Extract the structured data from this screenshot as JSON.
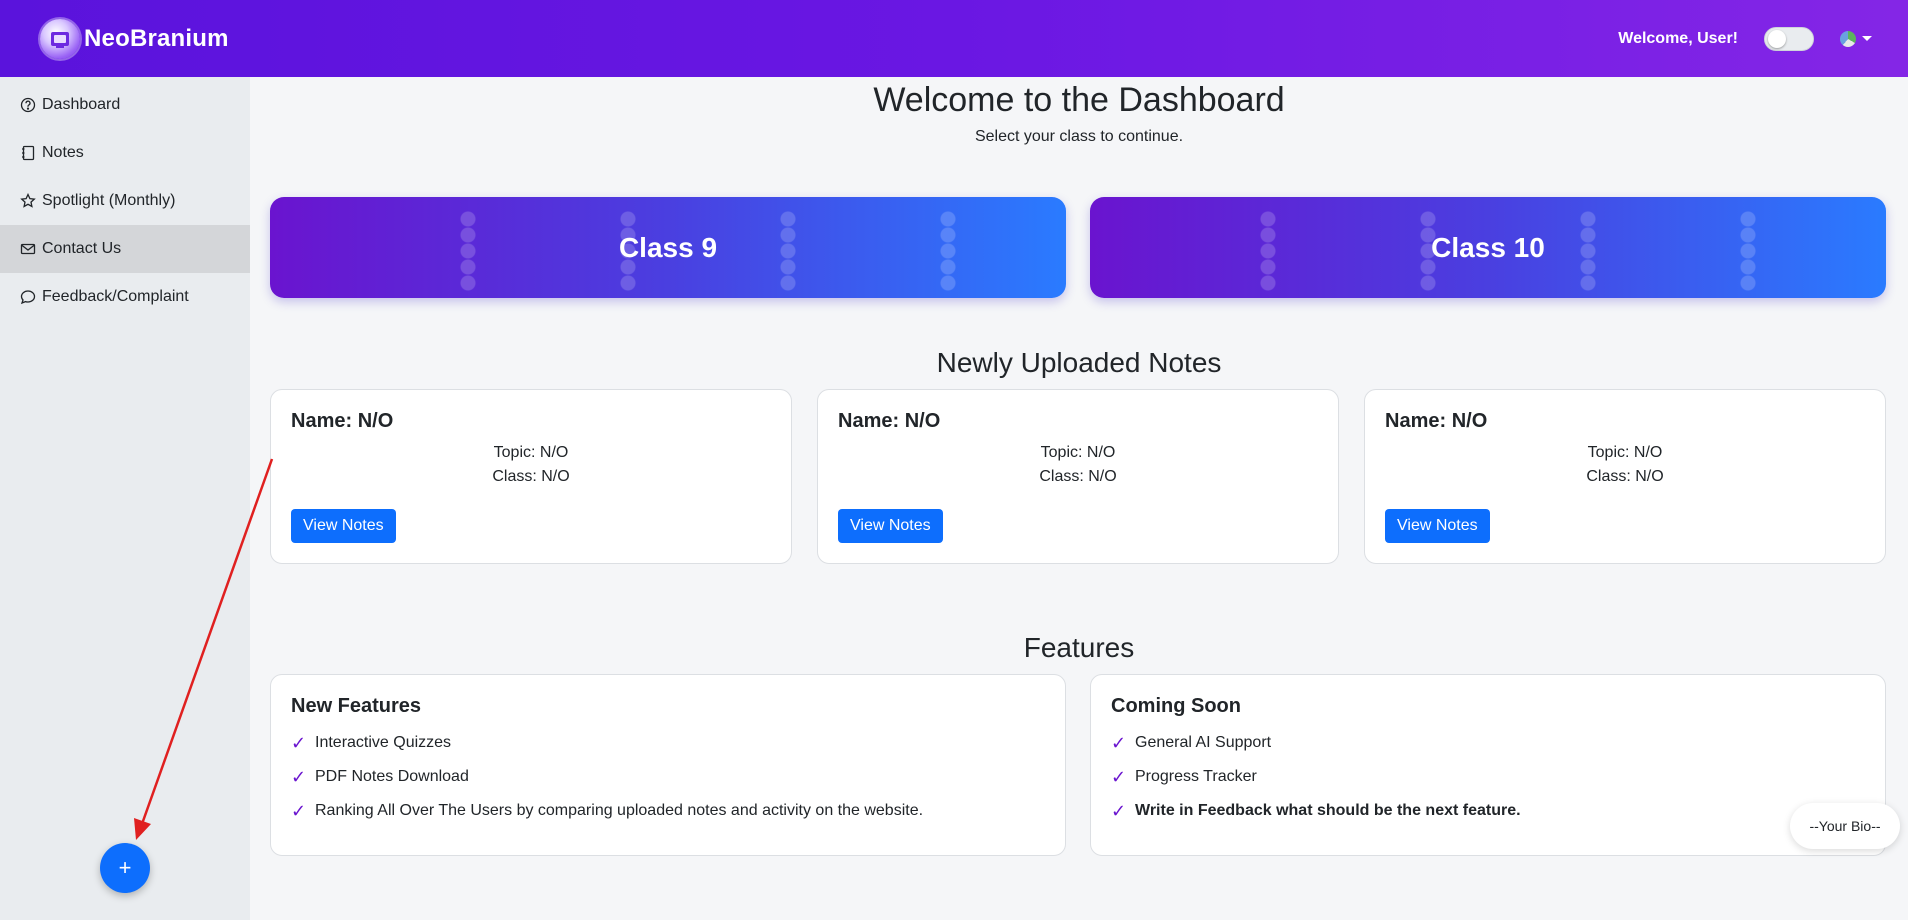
{
  "navbar": {
    "brand": "NeoBranium",
    "welcome": "Welcome, User!"
  },
  "sidebar": {
    "items": [
      {
        "label": "Dashboard",
        "icon": "question-circle-icon"
      },
      {
        "label": "Notes",
        "icon": "notebook-icon"
      },
      {
        "label": "Spotlight (Monthly)",
        "icon": "star-icon"
      },
      {
        "label": "Contact Us",
        "icon": "envelope-icon",
        "active": true
      },
      {
        "label": "Feedback/Complaint",
        "icon": "chat-bubble-icon"
      }
    ],
    "fab_label": "+"
  },
  "main": {
    "title": "Welcome to the Dashboard",
    "subtitle": "Select your class to continue.",
    "classes": [
      "Class 9",
      "Class 10"
    ],
    "notes_title": "Newly Uploaded Notes",
    "notes": [
      {
        "name": "Name: N/O",
        "topic": "Topic: N/O",
        "class": "Class: N/O",
        "button": "View Notes"
      },
      {
        "name": "Name: N/O",
        "topic": "Topic: N/O",
        "class": "Class: N/O",
        "button": "View Notes"
      },
      {
        "name": "Name: N/O",
        "topic": "Topic: N/O",
        "class": "Class: N/O",
        "button": "View Notes"
      }
    ],
    "features_title": "Features",
    "features": [
      {
        "title": "New Features",
        "items": [
          "Interactive Quizzes",
          "PDF Notes Download",
          "Ranking All Over The Users by comparing uploaded notes and activity on the website."
        ]
      },
      {
        "title": "Coming Soon",
        "items": [
          "General AI Support",
          "Progress Tracker",
          "Write in Feedback what should be the next feature."
        ]
      }
    ],
    "check_mark": "✓"
  },
  "bio": "--Your Bio--",
  "colors": {
    "nav_gradient_start": "#5a13dc",
    "nav_gradient_end": "#8426e6",
    "primary_button": "#0d6efd",
    "check": "#6a14cf",
    "annotation_arrow": "#e02020"
  }
}
